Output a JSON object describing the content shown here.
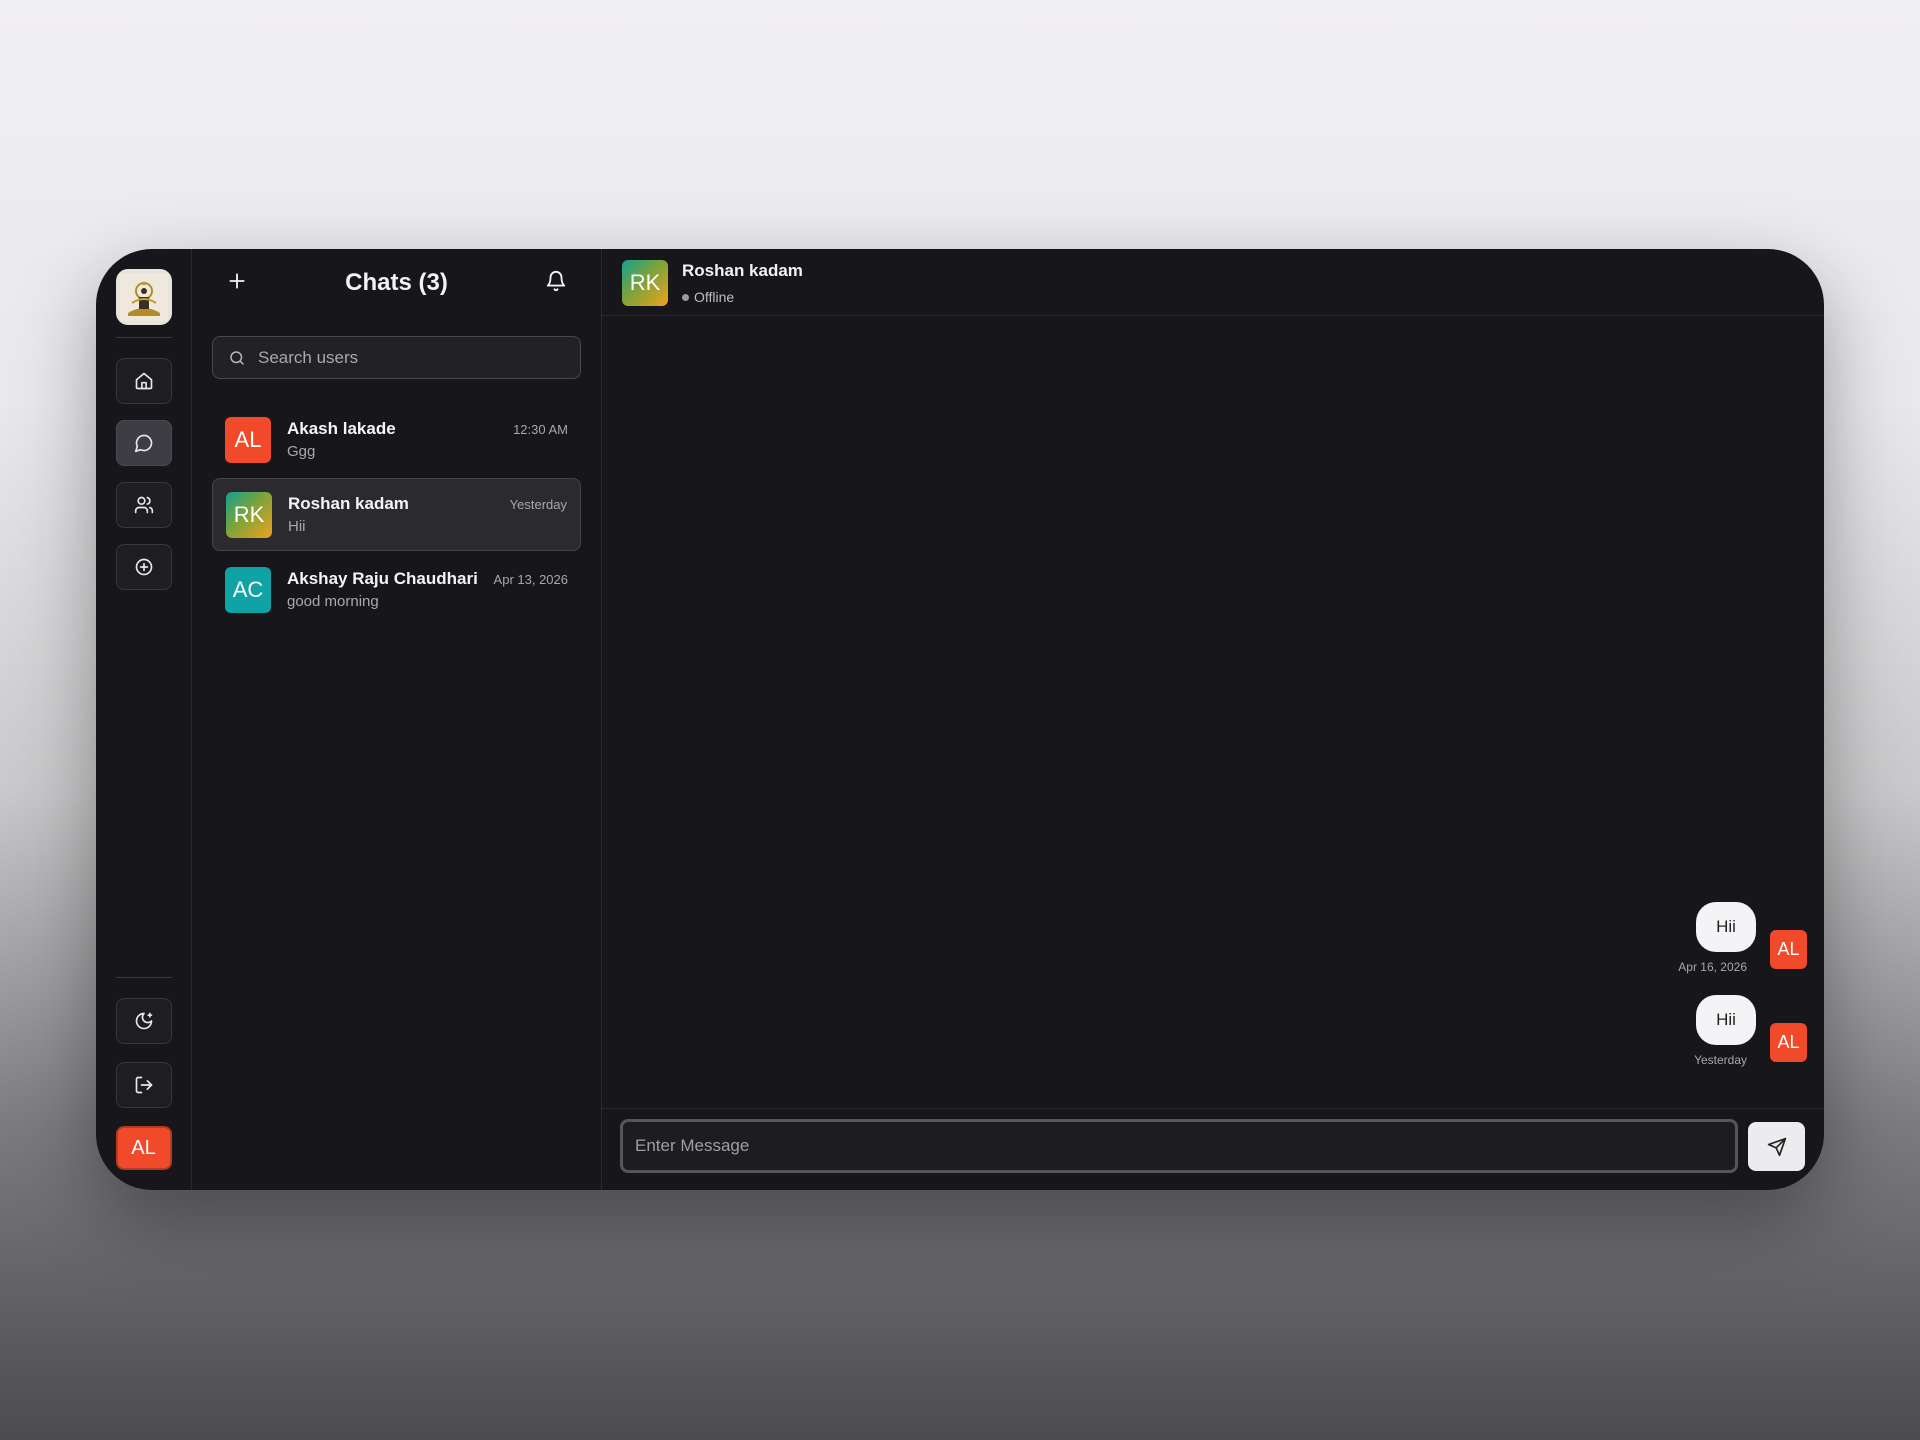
{
  "sidebar": {
    "nav": [
      {
        "icon": "home-icon",
        "active": false
      },
      {
        "icon": "message-circle-icon",
        "active": true
      },
      {
        "icon": "users-icon",
        "active": false
      },
      {
        "icon": "plus-circle-icon",
        "active": false
      }
    ],
    "bottom": [
      {
        "icon": "moon-star-icon"
      },
      {
        "icon": "logout-icon"
      }
    ],
    "user_initials": "AL"
  },
  "chat_list": {
    "title": "Chats (3)",
    "search_placeholder": "Search users",
    "items": [
      {
        "initials": "AL",
        "name": "Akash lakade",
        "time": "12:30 AM",
        "preview": "Ggg",
        "selected": false,
        "avatar_color": "#f04a2a"
      },
      {
        "initials": "RK",
        "name": "Roshan kadam",
        "time": "Yesterday",
        "preview": "Hii",
        "selected": true,
        "avatar_color": "gradient-teal-orange"
      },
      {
        "initials": "AC",
        "name": "Akshay Raju Chaudhari",
        "time": "Apr 13, 2026",
        "preview": "good morning",
        "selected": false,
        "avatar_color": "#0fa3a6"
      }
    ]
  },
  "conversation": {
    "contact_initials": "RK",
    "contact_name": "Roshan kadam",
    "contact_status": "Offline",
    "messages": [
      {
        "text": "Hii",
        "time": "Apr 16, 2026",
        "sender_initials": "AL"
      },
      {
        "text": "Hii",
        "time": "Yesterday",
        "sender_initials": "AL"
      }
    ],
    "input_placeholder": "Enter Message"
  },
  "colors": {
    "background": "#17161a",
    "accent_red": "#f04a2a",
    "teal": "#0fa3a6"
  }
}
